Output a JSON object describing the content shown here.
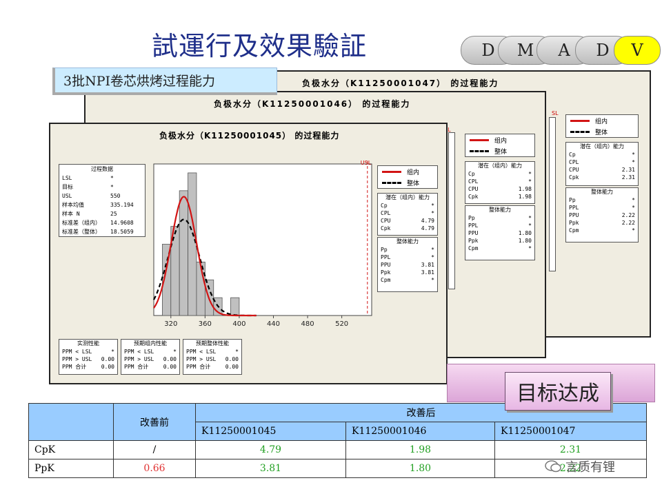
{
  "slide_title": "試運行及效果驗証",
  "phases": [
    {
      "label": "D"
    },
    {
      "label": "M"
    },
    {
      "label": "A"
    },
    {
      "label": "D"
    },
    {
      "label": "V"
    }
  ],
  "banner": "3批NPI卷芯烘烤过程能力",
  "panels": {
    "back": {
      "title": "负极水分（K11250001047） 的过程能力",
      "usl_mark": "SL",
      "legend": {
        "within": "组内",
        "overall": "整体"
      },
      "potential": {
        "header": "潜在（组内）能力",
        "rows": [
          [
            "Cp",
            "*"
          ],
          [
            "CPL",
            "*"
          ],
          [
            "CPU",
            "2.31"
          ],
          [
            "Cpk",
            "2.31"
          ]
        ]
      },
      "overall": {
        "header": "整体能力",
        "rows": [
          [
            "Pp",
            "*"
          ],
          [
            "PPL",
            "*"
          ],
          [
            "PPU",
            "2.22"
          ],
          [
            "Ppk",
            "2.22"
          ],
          [
            "Cpm",
            "*"
          ]
        ]
      }
    },
    "middle": {
      "title": "负极水分（K11250001046） 的过程能力",
      "usl_mark": "SL",
      "legend": {
        "within": "组内",
        "overall": "整体"
      },
      "potential": {
        "header": "潜在（组内）能力",
        "rows": [
          [
            "Cp",
            "*"
          ],
          [
            "CPL",
            "*"
          ],
          [
            "CPU",
            "1.98"
          ],
          [
            "Cpk",
            "1.98"
          ]
        ]
      },
      "overall": {
        "header": "整体能力",
        "rows": [
          [
            "Pp",
            "*"
          ],
          [
            "PPL",
            "*"
          ],
          [
            "PPU",
            "1.80"
          ],
          [
            "Ppk",
            "1.80"
          ],
          [
            "Cpm",
            "*"
          ]
        ]
      }
    },
    "front": {
      "title": "负极水分（K11250001045） 的过程能力",
      "usl_mark": "USL",
      "process": {
        "header": "过程数据",
        "rows": [
          [
            "LSL",
            "*"
          ],
          [
            "目标",
            "*"
          ],
          [
            "USL",
            "550"
          ],
          [
            "样本均值",
            "335.194"
          ],
          [
            "样本 N",
            "25"
          ],
          [
            "标准差（组内）",
            "14.9608"
          ],
          [
            "标准差（整体）",
            "18.5059"
          ]
        ]
      },
      "legend": {
        "within": "组内",
        "overall": "整体"
      },
      "potential": {
        "header": "潜在（组内）能力",
        "rows": [
          [
            "Cp",
            "*"
          ],
          [
            "CPL",
            "*"
          ],
          [
            "CPU",
            "4.79"
          ],
          [
            "Cpk",
            "4.79"
          ]
        ]
      },
      "overall": {
        "header": "整体能力",
        "rows": [
          [
            "Pp",
            "*"
          ],
          [
            "PPL",
            "*"
          ],
          [
            "PPU",
            "3.81"
          ],
          [
            "Ppk",
            "3.81"
          ],
          [
            "Cpm",
            "*"
          ]
        ]
      },
      "perf": [
        {
          "header": "实测性能",
          "rows": [
            [
              "PPM < LSL",
              "*"
            ],
            [
              "PPM > USL",
              "0.00"
            ],
            [
              "PPM 合计",
              "0.00"
            ]
          ]
        },
        {
          "header": "预期组内性能",
          "rows": [
            [
              "PPM < LSL",
              "*"
            ],
            [
              "PPM > USL",
              "0.00"
            ],
            [
              "PPM 合计",
              "0.00"
            ]
          ]
        },
        {
          "header": "预期整体性能",
          "rows": [
            [
              "PPM < LSL",
              "*"
            ],
            [
              "PPM > USL",
              "0.00"
            ],
            [
              "PPM 合计",
              "0.00"
            ]
          ]
        }
      ]
    }
  },
  "chart_data": {
    "type": "bar",
    "x": [
      310,
      320,
      330,
      340,
      350,
      360,
      370,
      380,
      390,
      400
    ],
    "values": [
      4,
      5,
      7,
      8,
      3,
      2,
      1,
      0,
      1,
      0
    ],
    "bin_width": 10,
    "xticks": [
      320,
      360,
      400,
      440,
      480,
      520
    ],
    "xlim": [
      300,
      555
    ],
    "usl": 550,
    "mean": 335.194,
    "sd_within": 14.9608,
    "sd_overall": 18.5059,
    "n": 25
  },
  "goal_label": "目标达成",
  "table": {
    "before_header": "改善前",
    "after_header": "改善后",
    "batches": [
      "K11250001045",
      "K11250001046",
      "K11250001047"
    ],
    "rows": [
      {
        "label": "CpK",
        "before": "/",
        "after": [
          "4.79",
          "1.98",
          "2.31"
        ]
      },
      {
        "label": "PpK",
        "before": "0.66",
        "after": [
          "3.81",
          "1.80",
          "2.22"
        ]
      }
    ]
  },
  "watermark": "言质有锂",
  "colors": {
    "title": "#1f2f8a",
    "within": "#d21414",
    "active_phase": "#ffff00",
    "after_values": "#22a022",
    "before_value": "#e03030",
    "table_header": "#99ccff"
  }
}
